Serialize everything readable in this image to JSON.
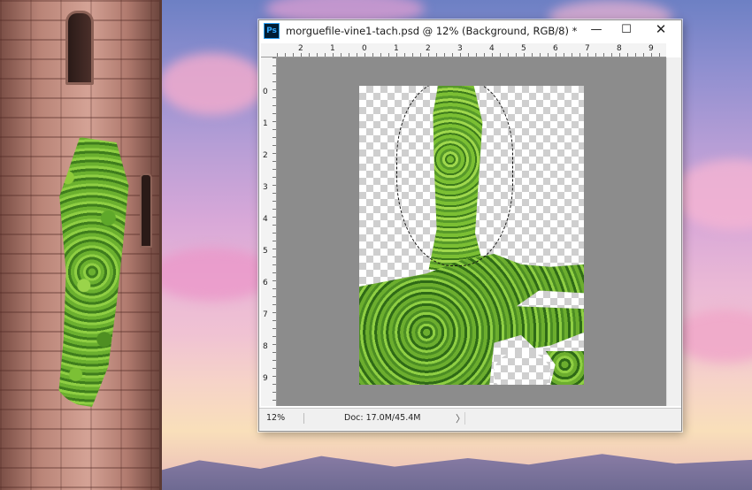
{
  "window": {
    "app_icon": "Ps",
    "title": "morguefile-vine1-tach.psd @ 12% (Background, RGB/8) *",
    "min_glyph": "—",
    "max_glyph": "☐",
    "close_glyph": "✕"
  },
  "ruler_top_ticks": [
    "2",
    "1",
    "0",
    "1",
    "2",
    "3",
    "4",
    "5",
    "6",
    "7",
    "8",
    "9"
  ],
  "ruler_left_ticks": [
    "0",
    "1",
    "2",
    "3",
    "4",
    "5",
    "6",
    "7",
    "8",
    "9"
  ],
  "status": {
    "zoom": "12%",
    "doc": "Doc: 17.0M/45.4M",
    "arrow": "〉"
  },
  "colors": {
    "pasteboard": "#8c8c8c",
    "ps_logo_bg": "#001d34",
    "ps_logo_fg": "#31a8ff"
  }
}
